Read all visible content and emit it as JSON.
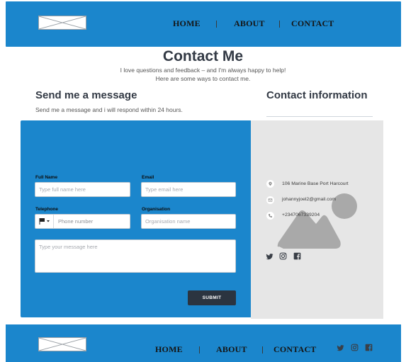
{
  "colors": {
    "primary": "#1b86cc",
    "dark": "#2b3440",
    "panel": "#e6e6e6"
  },
  "header": {
    "logo_icon": "image-placeholder-icon",
    "nav": [
      {
        "label": "HOME"
      },
      {
        "label": "ABOUT"
      },
      {
        "label": "CONTACT"
      }
    ]
  },
  "hero": {
    "title": "Contact Me",
    "subtitle_line1": "I love questions and feedback – and I'm always happy to help!",
    "subtitle_line2": "Here are some ways to contact me."
  },
  "message_section": {
    "heading": "Send me a message",
    "subheading": "Send me a message and i will respond within 24 hours."
  },
  "info_section": {
    "heading": "Contact information"
  },
  "form": {
    "full_name": {
      "label": "Full Name",
      "placeholder": "Type full name here",
      "value": ""
    },
    "email": {
      "label": "Email",
      "placeholder": "Type email here",
      "value": ""
    },
    "telephone": {
      "label": "Telephone",
      "placeholder": "Phone number",
      "value": "",
      "flag_icon": "flag-icon"
    },
    "organisation": {
      "label": "Organisation",
      "placeholder": "Organisation name",
      "value": ""
    },
    "message": {
      "placeholder": "Type your message here",
      "value": ""
    },
    "submit_label": "SUBMIT"
  },
  "contact_info": {
    "address": {
      "icon": "location-pin-icon",
      "text": "106 Marine Base Port Harcourt"
    },
    "email": {
      "icon": "envelope-icon",
      "text": "johannyjoel2@gmail.com"
    },
    "phone": {
      "icon": "phone-icon",
      "text": "+2347067339204"
    },
    "image_placeholder_icon": "image-placeholder-icon",
    "social": [
      "twitter-icon",
      "instagram-icon",
      "facebook-icon"
    ]
  },
  "footer": {
    "logo_icon": "image-placeholder-icon",
    "nav": [
      {
        "label": "HOME"
      },
      {
        "label": "ABOUT"
      },
      {
        "label": "CONTACT"
      }
    ],
    "social": [
      "twitter-icon",
      "instagram-icon",
      "facebook-icon"
    ]
  }
}
